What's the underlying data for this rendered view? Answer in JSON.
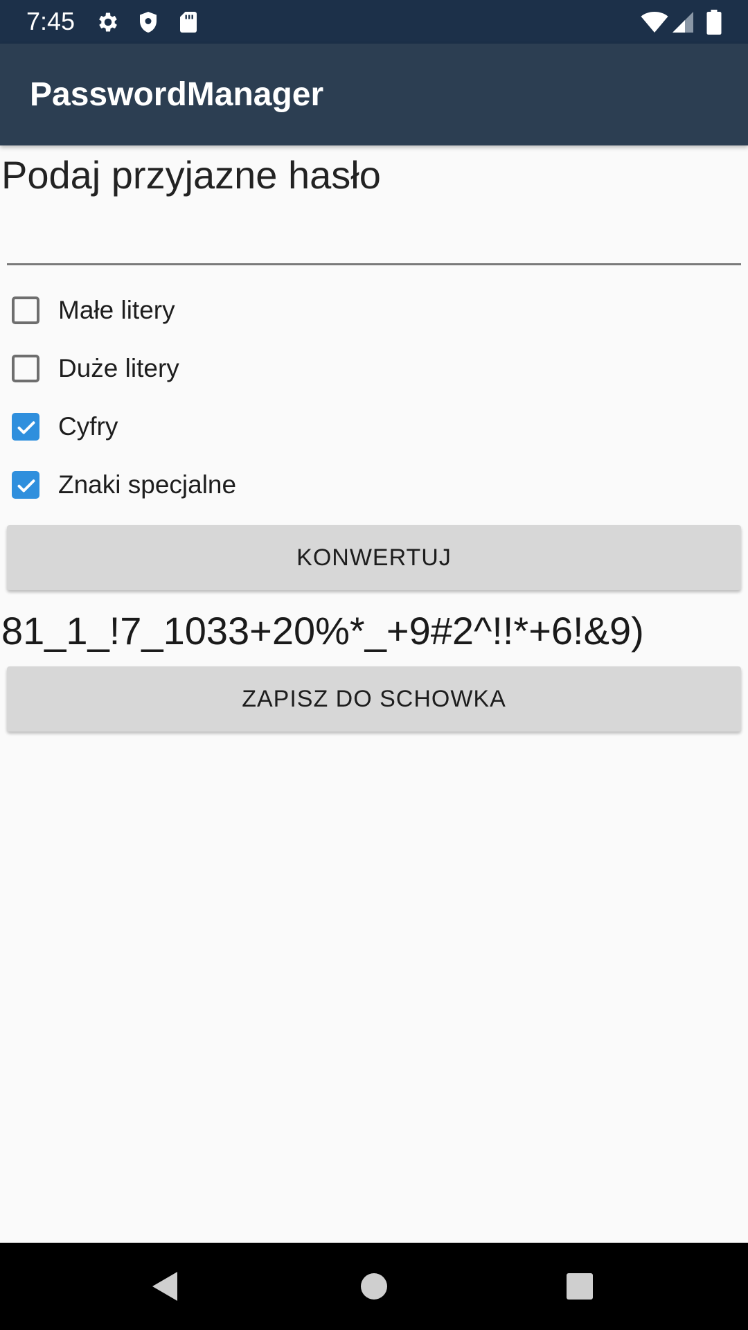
{
  "status_bar": {
    "time": "7:45",
    "icons": [
      "gear-icon",
      "shield-icon",
      "sd-card-icon",
      "wifi-icon",
      "signal-icon",
      "battery-icon"
    ]
  },
  "app_bar": {
    "title": "PasswordManager"
  },
  "main": {
    "prompt": "Podaj przyjazne hasło",
    "input": {
      "value": "",
      "placeholder": ""
    },
    "options": [
      {
        "label": "Małe litery",
        "checked": false
      },
      {
        "label": "Duże litery",
        "checked": false
      },
      {
        "label": "Cyfry",
        "checked": true
      },
      {
        "label": "Znaki specjalne",
        "checked": true
      }
    ],
    "convert_button": "KONWERTUJ",
    "result": "81_1_!7_1033+20%*_+9#2^!!*+6!&9)",
    "copy_button": "ZAPISZ DO SCHOWKA"
  },
  "colors": {
    "status_bar": "#1c3049",
    "app_bar": "#2c3e52",
    "accent": "#2f8fdd",
    "button": "#d7d7d7"
  },
  "nav_bar": {
    "icons": [
      "back-icon",
      "home-icon",
      "recents-icon"
    ]
  }
}
